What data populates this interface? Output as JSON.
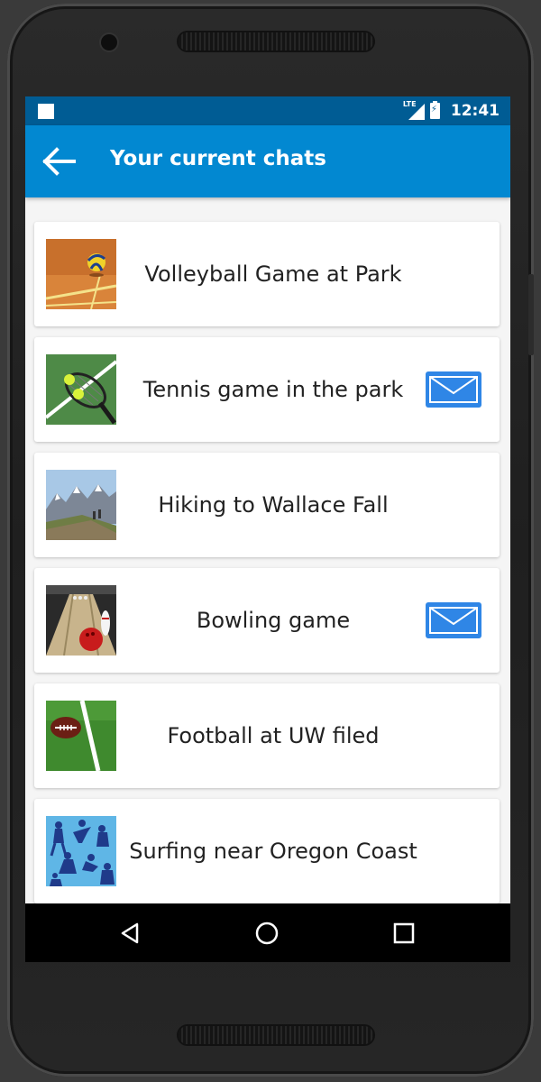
{
  "status_bar": {
    "network": "LTE",
    "time": "12:41"
  },
  "app_bar": {
    "title": "Your current chats",
    "back_icon": "arrow-left-icon"
  },
  "chats": [
    {
      "title": "Volleyball Game at Park",
      "has_message": false,
      "image": "volleyball-image"
    },
    {
      "title": "Tennis game in the park",
      "has_message": true,
      "image": "tennis-image"
    },
    {
      "title": "Hiking to Wallace Fall",
      "has_message": false,
      "image": "hiking-image"
    },
    {
      "title": "Bowling game",
      "has_message": true,
      "image": "bowling-image"
    },
    {
      "title": "Football at UW filed",
      "has_message": false,
      "image": "football-image"
    },
    {
      "title": "Surfing near Oregon Coast",
      "has_message": false,
      "image": "sports-silhouettes-image"
    }
  ],
  "nav_bar": {
    "back_icon": "nav-back-triangle-icon",
    "home_icon": "nav-home-circle-icon",
    "recents_icon": "nav-recents-square-icon"
  },
  "colors": {
    "status_bar": "#005c94",
    "app_bar": "#0288d1",
    "mail_button": "#2f86e6"
  }
}
